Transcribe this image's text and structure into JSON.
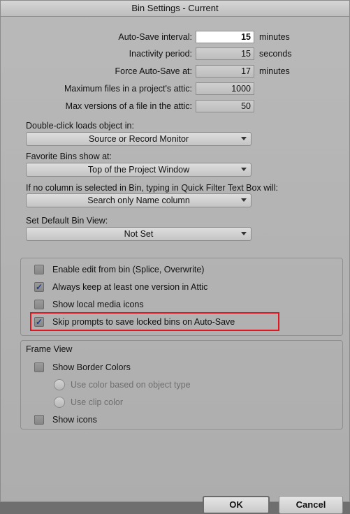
{
  "window": {
    "title": "Bin Settings - Current"
  },
  "autosave": {
    "interval_label": "Auto-Save interval:",
    "interval_value": "15",
    "interval_unit": "minutes",
    "inactivity_label": "Inactivity period:",
    "inactivity_value": "15",
    "inactivity_unit": "seconds",
    "force_label": "Force Auto-Save at:",
    "force_value": "17",
    "force_unit": "minutes",
    "max_files_label": "Maximum files in a project's attic:",
    "max_files_value": "1000",
    "max_versions_label": "Max versions of a file in the attic:",
    "max_versions_value": "50"
  },
  "double_click": {
    "label": "Double-click loads object in:",
    "value": "Source or Record Monitor"
  },
  "favorite_bins": {
    "label": "Favorite Bins show at:",
    "value": "Top of the Project Window"
  },
  "quick_filter": {
    "label": "If no column is selected in Bin, typing in Quick Filter Text Box will:",
    "value": "Search only Name column"
  },
  "default_view": {
    "label": "Set Default Bin View:",
    "value": "Not Set"
  },
  "options": [
    {
      "label": "Enable edit from bin (Splice, Overwrite)",
      "checked": false
    },
    {
      "label": "Always keep at least one version in Attic",
      "checked": true
    },
    {
      "label": "Show local media icons",
      "checked": false
    },
    {
      "label": "Skip prompts to save locked bins on Auto-Save",
      "checked": true
    }
  ],
  "frame_view": {
    "title": "Frame View",
    "show_border_colors": "Show Border Colors",
    "radio_object_type": "Use color based on object type",
    "radio_clip_color": "Use clip color",
    "show_icons": "Show icons"
  },
  "buttons": {
    "ok": "OK",
    "cancel": "Cancel"
  },
  "colors": {
    "highlight": "#e3151e",
    "background": "#b3b3b3",
    "check": "#1f3f8f"
  }
}
